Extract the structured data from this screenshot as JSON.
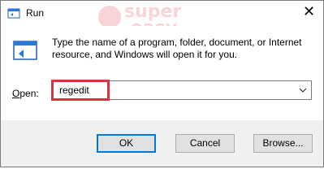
{
  "window": {
    "title": "Run",
    "close_glyph": "✕"
  },
  "watermark": {
    "line1": "super",
    "line2": "easy"
  },
  "content": {
    "description": "Type the name of a program, folder, document, or Internet resource, and Windows will open it for you.",
    "open_label_underlined": "O",
    "open_label_rest": "pen:",
    "open_value": "regedit",
    "highlight_color": "#d9333f"
  },
  "buttons": {
    "ok": "OK",
    "cancel": "Cancel",
    "browse": "Browse..."
  }
}
